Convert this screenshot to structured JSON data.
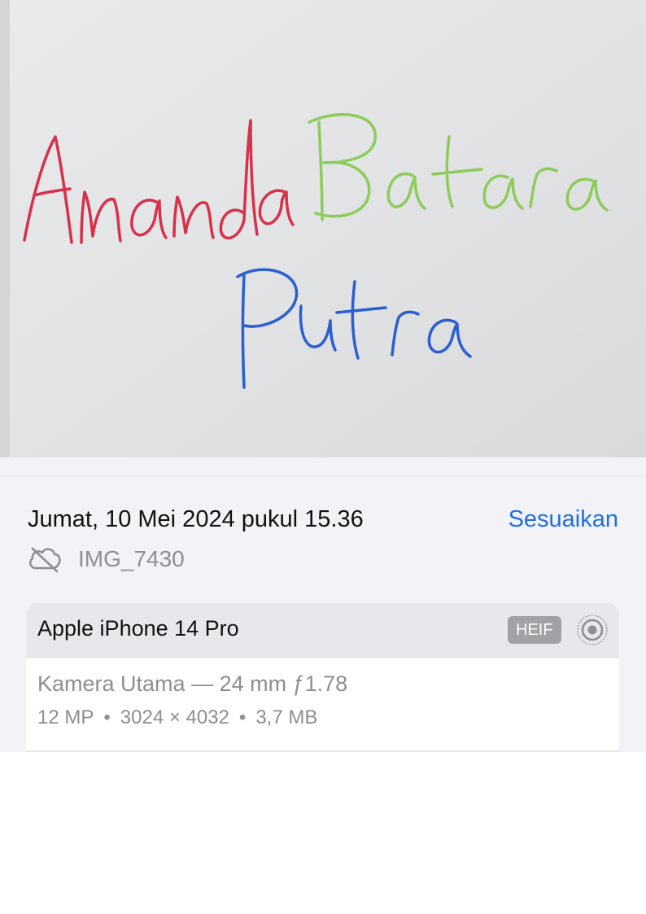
{
  "photo": {
    "handwriting": {
      "line1_red": "Ananda",
      "line1_green": "Batara",
      "line2_blue": "Putra"
    },
    "ink_colors": {
      "red": "#d9304a",
      "green": "#8dcc5a",
      "blue": "#2b5fd1"
    }
  },
  "info": {
    "datetime": "Jumat, 10 Mei 2024 pukul 15.36",
    "adjust_label": "Sesuaikan",
    "filename": "IMG_7430",
    "cloud_icon": "cloud-slash-icon"
  },
  "camera": {
    "device": "Apple iPhone 14 Pro",
    "format": "HEIF",
    "live_icon": "live-photo-icon",
    "lens": "Kamera Utama — 24 mm ƒ1.78",
    "megapixels": "12 MP",
    "resolution": "3024 × 4032",
    "size": "3,7 MB",
    "separator": "•"
  },
  "colors": {
    "accent": "#1f6fe0",
    "secondary_text": "#8e8e93",
    "sheet_bg": "#f2f2f7"
  }
}
